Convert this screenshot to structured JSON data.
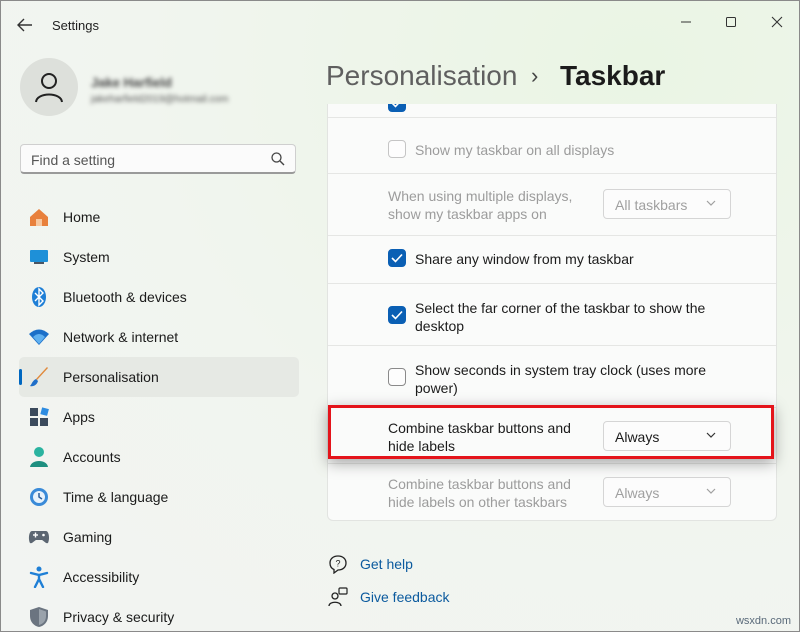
{
  "window": {
    "title": "Settings",
    "back_icon": "back-arrow-icon",
    "controls": [
      "minimize-icon",
      "maximize-icon",
      "close-icon"
    ]
  },
  "account": {
    "name": "Jake Harfield",
    "email": "jakeharfield2019@hotmail.com"
  },
  "search": {
    "placeholder": "Find a setting",
    "value": ""
  },
  "nav": {
    "items": [
      {
        "label": "Home",
        "icon": "home-icon",
        "selected": false
      },
      {
        "label": "System",
        "icon": "system-icon",
        "selected": false
      },
      {
        "label": "Bluetooth & devices",
        "icon": "bluetooth-icon",
        "selected": false
      },
      {
        "label": "Network & internet",
        "icon": "network-icon",
        "selected": false
      },
      {
        "label": "Personalisation",
        "icon": "brush-icon",
        "selected": true
      },
      {
        "label": "Apps",
        "icon": "apps-icon",
        "selected": false
      },
      {
        "label": "Accounts",
        "icon": "accounts-icon",
        "selected": false
      },
      {
        "label": "Time & language",
        "icon": "time-language-icon",
        "selected": false
      },
      {
        "label": "Gaming",
        "icon": "gaming-icon",
        "selected": false
      },
      {
        "label": "Accessibility",
        "icon": "accessibility-icon",
        "selected": false
      },
      {
        "label": "Privacy & security",
        "icon": "privacy-icon",
        "selected": false
      }
    ]
  },
  "header": {
    "parent": "Personalisation",
    "separator": "›",
    "current": "Taskbar"
  },
  "settings": {
    "show_on_all_displays": {
      "label": "Show my taskbar on all displays",
      "checked": false,
      "disabled": true
    },
    "multiple_displays": {
      "label_line1": "When using multiple displays,",
      "label_line2": "show my taskbar apps on",
      "value": "All taskbars",
      "disabled": true
    },
    "share_window": {
      "label": "Share any window from my taskbar",
      "checked": true
    },
    "far_corner": {
      "label_line1": "Select the far corner of the taskbar to show the",
      "label_line2": "desktop",
      "checked": true
    },
    "show_seconds": {
      "label_line1": "Show seconds in system tray clock (uses more",
      "label_line2": "power)",
      "checked": false
    },
    "combine_buttons": {
      "label_line1": "Combine taskbar buttons and",
      "label_line2": "hide labels",
      "value": "Always",
      "highlighted": true
    },
    "combine_other": {
      "label_line1": "Combine taskbar buttons and",
      "label_line2": "hide labels on other taskbars",
      "value": "Always",
      "disabled": true
    }
  },
  "links": {
    "help": {
      "label": "Get help",
      "icon": "get-help-icon"
    },
    "feedback": {
      "label": "Give feedback",
      "icon": "feedback-icon"
    }
  },
  "colors": {
    "accent": "#0a5fb4",
    "highlight_border": "#e4141b",
    "link": "#0b5a9e"
  },
  "watermark": "wsxdn.com"
}
